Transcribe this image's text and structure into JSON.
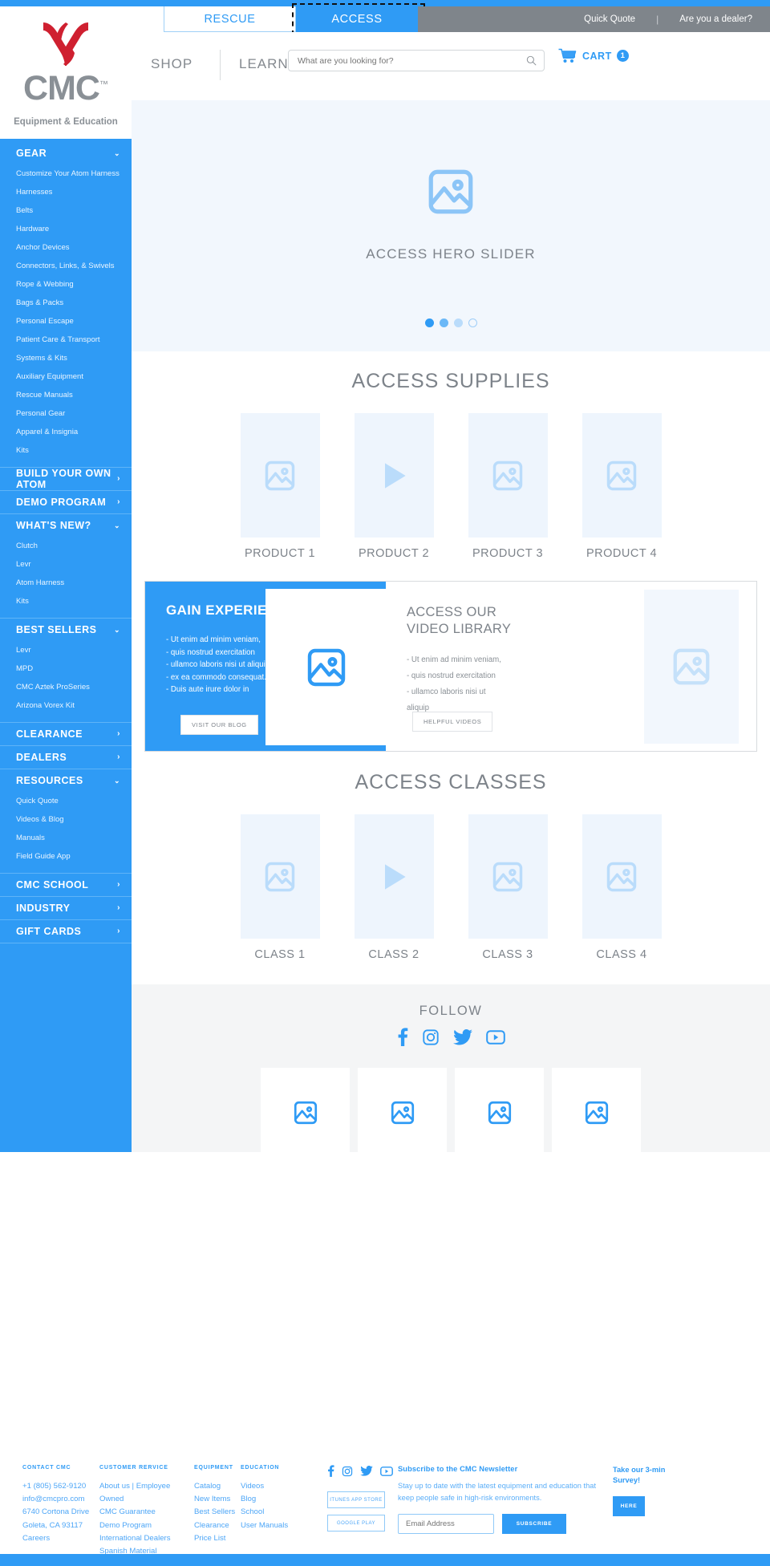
{
  "colors": {
    "brand_blue": "#2f9bf5",
    "logo_red": "#cf2030",
    "gray_text": "#7d838a",
    "gray_bar": "#7f858b"
  },
  "topbar": {
    "tabs": [
      {
        "label": "RESCUE",
        "active": false
      },
      {
        "label": "ACCESS",
        "active": true
      }
    ],
    "quick_quote": "Quick Quote",
    "dealer": "Are you a dealer?"
  },
  "brand": {
    "name": "CMC",
    "tm": "™",
    "tagline": "Equipment & Education"
  },
  "mainnav": {
    "shop": "SHOP",
    "learn": "LEARN",
    "search_placeholder": "What are you looking for?",
    "cart_label": "CART",
    "cart_count": "1"
  },
  "sidebar": {
    "groups": [
      {
        "title": "GEAR",
        "chevron": "⌄",
        "items": [
          "Customize Your Atom Harness",
          "Harnesses",
          "Belts",
          "Hardware",
          "Anchor Devices",
          "Connectors, Links, & Swivels",
          "Rope & Webbing",
          "Bags & Packs",
          "Personal Escape",
          "Patient Care & Transport",
          "Systems & Kits",
          "Auxiliary Equipment",
          "Rescue Manuals",
          "Personal Gear",
          "Apparel & Insignia",
          "Kits"
        ]
      },
      {
        "title": "BUILD YOUR OWN ATOM",
        "chevron": "›",
        "items": []
      },
      {
        "title": "DEMO PROGRAM",
        "chevron": "›",
        "items": []
      },
      {
        "title": "WHAT'S NEW?",
        "chevron": "⌄",
        "items": [
          "Clutch",
          "Levr",
          "Atom Harness",
          "Kits"
        ]
      },
      {
        "title": "BEST SELLERS",
        "chevron": "⌄",
        "items": [
          "Levr",
          "MPD",
          "CMC Aztek ProSeries",
          "Arizona Vorex Kit"
        ]
      },
      {
        "title": "CLEARANCE",
        "chevron": "›",
        "items": []
      },
      {
        "title": "DEALERS",
        "chevron": "›",
        "items": []
      },
      {
        "title": "RESOURCES",
        "chevron": "⌄",
        "items": [
          "Quick Quote",
          "Videos & Blog",
          "Manuals",
          "Field Guide App"
        ]
      },
      {
        "title": "CMC SCHOOL",
        "chevron": "›",
        "items": []
      },
      {
        "title": "INDUSTRY",
        "chevron": "›",
        "items": []
      },
      {
        "title": "GIFT CARDS",
        "chevron": "›",
        "items": []
      }
    ]
  },
  "hero": {
    "label": "ACCESS HERO SLIDER",
    "icon": "image-placeholder-icon",
    "dots": 4,
    "active_dot": 1
  },
  "supplies": {
    "title": "ACCESS SUPPLIES",
    "cards": [
      {
        "name": "PRODUCT 1",
        "icon": "image-placeholder-icon"
      },
      {
        "name": "PRODUCT 2",
        "icon": "play-icon"
      },
      {
        "name": "PRODUCT 3",
        "icon": "image-placeholder-icon"
      },
      {
        "name": "PRODUCT 4",
        "icon": "image-placeholder-icon"
      }
    ]
  },
  "promo": {
    "left": {
      "heading": "GAIN EXPERIENCE",
      "bullets": [
        "- Ut enim ad minim veniam,",
        "- quis nostrud exercitation",
        "- ullamco laboris nisi ut aliquip",
        "- ex ea commodo consequat.",
        "- Duis aute irure dolor in"
      ],
      "button": "VISIT OUR BLOG",
      "icon": "image-placeholder-icon"
    },
    "right": {
      "heading_line1": "ACCESS OUR",
      "heading_line2": "VIDEO LIBRARY",
      "bullets": [
        "- Ut enim ad minim veniam,",
        "- quis nostrud exercitation",
        "- ullamco laboris nisi ut",
        "aliquip"
      ],
      "button": "HELPFUL VIDEOS",
      "icon": "image-placeholder-icon"
    }
  },
  "classes": {
    "title": "ACCESS CLASSES",
    "cards": [
      {
        "name": "CLASS 1",
        "icon": "image-placeholder-icon"
      },
      {
        "name": "CLASS 2",
        "icon": "play-icon"
      },
      {
        "name": "CLASS 3",
        "icon": "image-placeholder-icon"
      },
      {
        "name": "CLASS 4",
        "icon": "image-placeholder-icon"
      }
    ]
  },
  "follow": {
    "title": "FOLLOW",
    "socials": [
      "facebook-icon",
      "instagram-icon",
      "twitter-icon",
      "youtube-icon"
    ],
    "grid_rows": 2,
    "grid_cols": 4
  },
  "footer": {
    "columns": [
      {
        "heading": "CONTACT CMC",
        "links": [
          "+1 (805) 562-9120",
          "info@cmcpro.com",
          "6740 Cortona Drive",
          "Goleta, CA 93117",
          "Careers"
        ]
      },
      {
        "heading": "CUSTOMER RERVICE",
        "links": [
          "About us | Employee Owned",
          "CMC Guarantee",
          "Demo Program",
          "International Dealers",
          "Spanish Material"
        ]
      },
      {
        "heading": "EQUIPMENT",
        "links": [
          "Catalog",
          "New Items",
          "Best Sellers",
          "Clearance",
          "Price List"
        ]
      },
      {
        "heading": "EDUCATION",
        "links": [
          "Videos",
          "Blog",
          "School",
          "User Manuals"
        ]
      }
    ],
    "socials": [
      "facebook-icon",
      "instagram-icon",
      "twitter-icon",
      "youtube-icon"
    ],
    "store_buttons": [
      "ITUNES APP STORE",
      "GOOGLE PLAY"
    ],
    "newsletter": {
      "heading": "Subscribe to the CMC Newsletter",
      "body": "Stay up to date with the latest equipment and education that keep people safe in high-risk environments.",
      "input_placeholder": "Email Address",
      "button": "SUBSCRIBE"
    },
    "survey": {
      "heading": "Take our 3-min Survey!",
      "button": "HERE"
    }
  }
}
